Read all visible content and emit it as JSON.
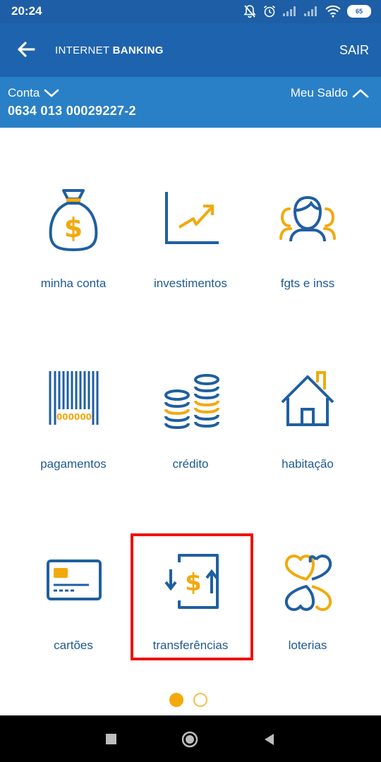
{
  "status_bar": {
    "time": "20:24",
    "battery": "65"
  },
  "app_bar": {
    "title_regular": "INTERNET ",
    "title_bold": "BANKING",
    "logout_label": "SAIR"
  },
  "account": {
    "label": "Conta",
    "number": "0634 013 00029227-2",
    "balance_label": "Meu Saldo"
  },
  "menu": [
    {
      "label": "minha conta",
      "icon": "money-bag-icon"
    },
    {
      "label": "investimentos",
      "icon": "growth-chart-icon"
    },
    {
      "label": "fgts e inss",
      "icon": "people-icon"
    },
    {
      "label": "pagamentos",
      "icon": "barcode-icon",
      "barcode_text": "000000"
    },
    {
      "label": "crédito",
      "icon": "coin-stacks-icon"
    },
    {
      "label": "habitação",
      "icon": "house-icon"
    },
    {
      "label": "cartões",
      "icon": "credit-card-icon"
    },
    {
      "label": "transferências",
      "icon": "transfer-icon"
    },
    {
      "label": "loterias",
      "icon": "clover-icon"
    }
  ],
  "pagination": {
    "pages": 2,
    "current": 1
  },
  "colors": {
    "primary_blue": "#1e63ad",
    "account_blue": "#2a80c6",
    "icon_blue": "#1f5fa0",
    "accent_yellow": "#f2a90c",
    "label_blue": "#1e5a94",
    "highlight_red": "#ee1111"
  }
}
